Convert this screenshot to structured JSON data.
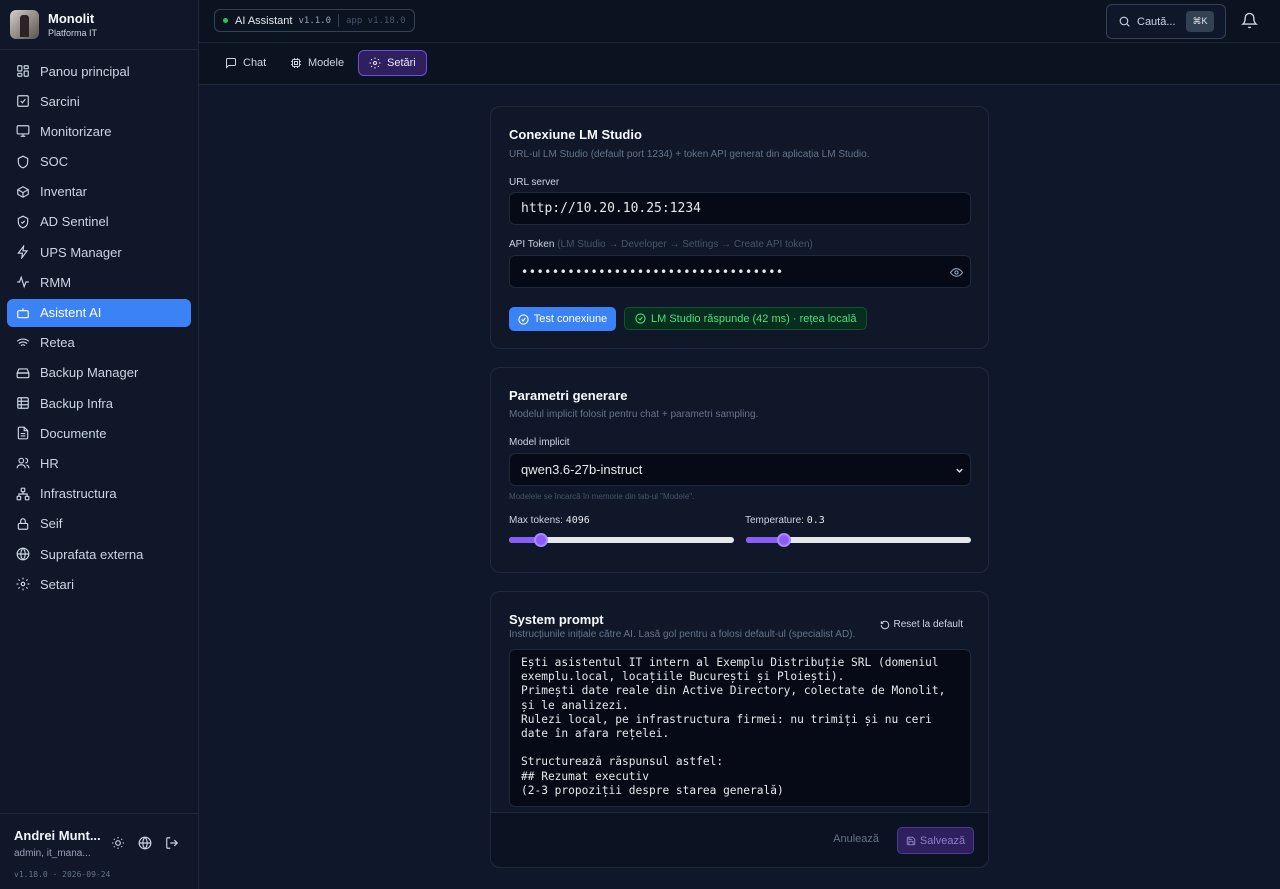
{
  "brand": {
    "name": "Monolit",
    "subtitle": "Platforma IT"
  },
  "sidebar": {
    "items": [
      {
        "label": "Panou principal",
        "icon": "dashboard-icon"
      },
      {
        "label": "Sarcini",
        "icon": "checkbox-icon"
      },
      {
        "label": "Monitorizare",
        "icon": "monitor-icon"
      },
      {
        "label": "SOC",
        "icon": "shield-icon"
      },
      {
        "label": "Inventar",
        "icon": "package-icon"
      },
      {
        "label": "AD Sentinel",
        "icon": "shield-check-icon"
      },
      {
        "label": "UPS Manager",
        "icon": "zap-icon"
      },
      {
        "label": "RMM",
        "icon": "activity-icon"
      },
      {
        "label": "Asistent AI",
        "icon": "bot-icon",
        "active": true
      },
      {
        "label": "Retea",
        "icon": "wifi-icon"
      },
      {
        "label": "Backup Manager",
        "icon": "hard-drive-icon"
      },
      {
        "label": "Backup Infra",
        "icon": "database-icon"
      },
      {
        "label": "Documente",
        "icon": "file-text-icon"
      },
      {
        "label": "HR",
        "icon": "users-icon"
      },
      {
        "label": "Infrastructura",
        "icon": "network-icon"
      },
      {
        "label": "Seif",
        "icon": "lock-icon"
      },
      {
        "label": "Suprafata externa",
        "icon": "globe-icon"
      },
      {
        "label": "Setari",
        "icon": "gear-icon"
      }
    ]
  },
  "user": {
    "name": "Andrei Munt...",
    "role": "admin, it_mana...",
    "version": "v1.18.0 · 2026-09-24"
  },
  "topbar": {
    "app_name": "AI Assistant",
    "app_version": "v1.1.0",
    "platform_version": "app v1.18.0",
    "search_placeholder": "Caută...",
    "shortcut": "⌘K"
  },
  "tabs": [
    {
      "label": "Chat",
      "icon": "chat-icon"
    },
    {
      "label": "Modele",
      "icon": "cpu-icon"
    },
    {
      "label": "Setări",
      "icon": "gear-icon",
      "active": true
    }
  ],
  "connection": {
    "title": "Conexiune LM Studio",
    "description": "URL-ul LM Studio (default port 1234) + token API generat din aplicația LM Studio.",
    "url_label": "URL server",
    "url_value": "http://10.20.10.25:1234",
    "token_label": "API Token",
    "token_hint": "(LM Studio → Developer → Settings → Create API token)",
    "token_value": "••••••••••••••••••••••••••••••••••",
    "test_button": "Test conexiune",
    "status": "LM Studio răspunde (42 ms) · rețea locală",
    "status_color": "#4ade80"
  },
  "generation": {
    "title": "Parametri generare",
    "description": "Modelul implicit folosit pentru chat + parametri sampling.",
    "model_label": "Model implicit",
    "model_value": "qwen3.6-27b-instruct",
    "model_hint": "Modelele se încarcă în memorie din tab-ul \"Modele\".",
    "max_tokens_label": "Max tokens:",
    "max_tokens_value": "4096",
    "max_tokens_fraction": 0.14,
    "temperature_label": "Temperature:",
    "temperature_value": "0.3",
    "temperature_fraction": 0.17,
    "accent_color": "#8b5cf6"
  },
  "system_prompt": {
    "title": "System prompt",
    "description": "Instrucțiunile inițiale către AI. Lasă gol pentru a folosi default-ul (specialist AD).",
    "reset_label": "Reset la default",
    "text": "Ești asistentul IT intern al Exemplu Distribuție SRL (domeniul exemplu.local, locațiile București și Ploiești).\nPrimești date reale din Active Directory, colectate de Monolit, și le analizezi.\nRulezi local, pe infrastructura firmei: nu trimiți și nu ceri date în afara rețelei.\n\nStructurează răspunsul astfel:\n## Rezumat executiv\n(2-3 propoziții despre starea generală)",
    "cancel_label": "Anulează",
    "save_label": "Salvează"
  }
}
